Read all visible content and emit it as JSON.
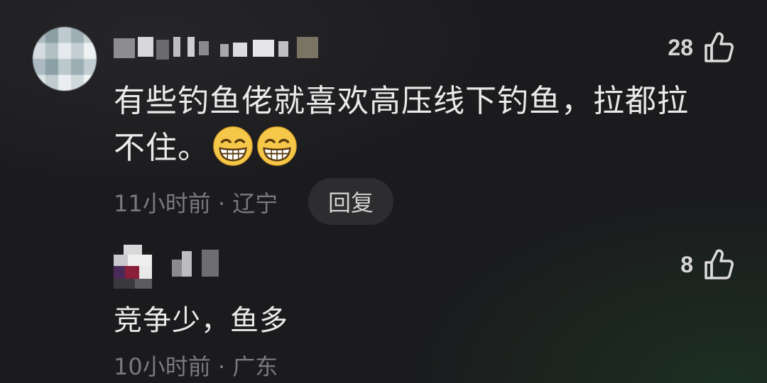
{
  "comments": [
    {
      "likes": "28",
      "text_line1": "有些钓鱼佬就喜欢高压线下钓鱼，拉都拉",
      "text_line2": "不住。",
      "emojis": [
        "grin-emoji",
        "grin-emoji"
      ],
      "meta": "11小时前 · 辽宁",
      "reply_label": "回复"
    },
    {
      "likes": "8",
      "text": "竞争少，鱼多",
      "meta": "10小时前 · 广东"
    }
  ],
  "colors": {
    "background": "#1b1b1d",
    "text": "#eaeaea",
    "meta": "#7a7a7d",
    "reply_bg": "#2d2d30"
  }
}
